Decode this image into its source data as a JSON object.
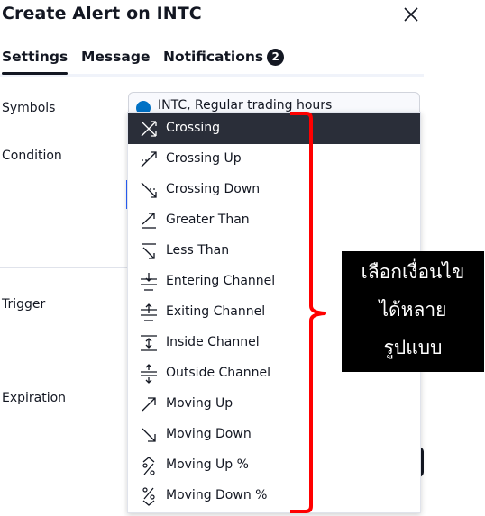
{
  "dialog": {
    "title": "Create Alert on INTC"
  },
  "tabs": [
    {
      "label": "Settings",
      "active": true
    },
    {
      "label": "Message",
      "active": false
    },
    {
      "label": "Notifications",
      "badge": "2",
      "active": false
    }
  ],
  "fields": {
    "symbols_label": "Symbols",
    "condition_label": "Condition",
    "trigger_label": "Trigger",
    "expiration_label": "Expiration",
    "symbol_value": "INTC, Regular trading hours"
  },
  "dropdown": {
    "items": [
      {
        "label": "Crossing",
        "icon": "crossing-icon",
        "selected": true
      },
      {
        "label": "Crossing Up",
        "icon": "crossing-up-icon"
      },
      {
        "label": "Crossing Down",
        "icon": "crossing-down-icon"
      },
      {
        "label": "Greater Than",
        "icon": "greater-than-icon"
      },
      {
        "label": "Less Than",
        "icon": "less-than-icon"
      },
      {
        "label": "Entering Channel",
        "icon": "entering-channel-icon"
      },
      {
        "label": "Exiting Channel",
        "icon": "exiting-channel-icon"
      },
      {
        "label": "Inside Channel",
        "icon": "inside-channel-icon"
      },
      {
        "label": "Outside Channel",
        "icon": "outside-channel-icon"
      },
      {
        "label": "Moving Up",
        "icon": "moving-up-icon"
      },
      {
        "label": "Moving Down",
        "icon": "moving-down-icon"
      },
      {
        "label": "Moving Up %",
        "icon": "moving-up-percent-icon"
      },
      {
        "label": "Moving Down %",
        "icon": "moving-down-percent-icon"
      }
    ]
  },
  "annotation": {
    "lines": [
      "เลือกเงื่อนไข",
      "ได้หลาย",
      "รูปแบบ"
    ],
    "bracket_color": "#ff0000"
  },
  "colors": {
    "selected_bg": "#2a2e39",
    "accent": "#2962ff"
  }
}
